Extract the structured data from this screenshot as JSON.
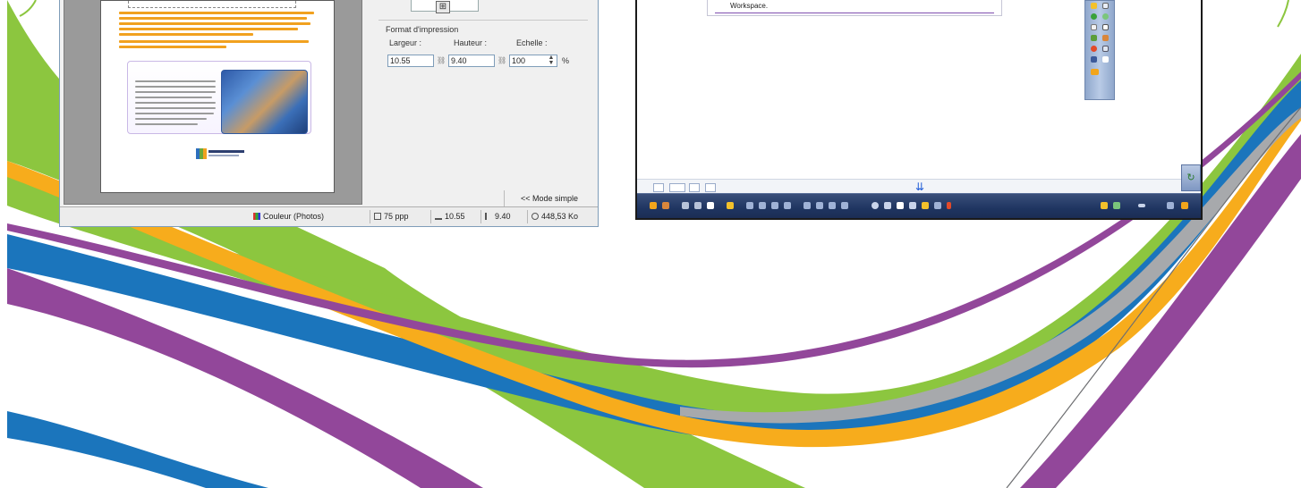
{
  "colors": {
    "green": "#8cc63f",
    "blue": "#1b75bc",
    "purple": "#92479a",
    "orange": "#f7ac1c",
    "grey": "#a7a9ac"
  },
  "scan_dialog": {
    "print_format": {
      "heading": "Format d'impression",
      "width_label": "Largeur :",
      "height_label": "Hauteur :",
      "scale_label": "Echelle :",
      "width_value": "10.55",
      "height_value": "9.40",
      "scale_value": "100",
      "scale_unit": "%",
      "link_icon": "link-icon",
      "spin_icon": "spinner-arrows-icon"
    },
    "mode_button": "<< Mode simple",
    "status": {
      "color_mode": "Couleur (Photos)",
      "resolution": "75 ppp",
      "width": "10.55",
      "height": "9.40",
      "size": "448,53 Ko"
    }
  },
  "whiteboard": {
    "workspace_label": "Workspace.",
    "down_arrow": "⇊",
    "corner_icon": "↻"
  }
}
